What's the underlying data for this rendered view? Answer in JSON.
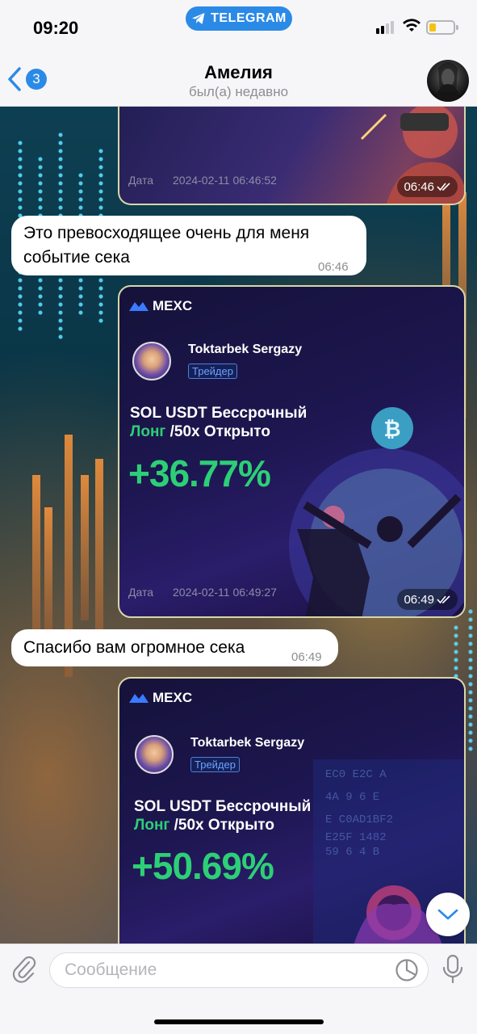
{
  "status_bar": {
    "time": "09:20",
    "app_pill": "TELEGRAM"
  },
  "header": {
    "back_count": "3",
    "contact_name": "Амелия",
    "contact_status": "был(а) недавно"
  },
  "messages": [
    {
      "type": "image",
      "date_label": "Дата",
      "date_value": "2024-02-11 06:46:52",
      "time": "06:46"
    },
    {
      "type": "text",
      "text_line1": "Это превосходящее очень для меня",
      "text_line2": "событие сека",
      "time": "06:46"
    },
    {
      "type": "image",
      "brand": "MEXC",
      "trader_name": "Toktarbek Sergazy",
      "trader_badge": "Трейдер",
      "pair_line1": "SOL USDT Бессрочный",
      "pair_side": "Лонг",
      "pair_rest": "/50x Открыто",
      "profit": "+36.77%",
      "date_label": "Дата",
      "date_value": "2024-02-11 06:49:27",
      "time": "06:49"
    },
    {
      "type": "text",
      "text_line1": "Спасибо вам огромное сека",
      "time": "06:49"
    },
    {
      "type": "image",
      "brand": "MEXC",
      "trader_name": "Toktarbek Sergazy",
      "trader_badge": "Трейдер",
      "pair_line1": "SOL USDT Бессрочный",
      "pair_side": "Лонг",
      "pair_rest": "/50x Открыто",
      "profit": "+50.69%"
    }
  ],
  "composer": {
    "placeholder": "Сообщение"
  },
  "icons": {
    "attach": "paperclip-icon",
    "sticker": "sticker-icon",
    "mic": "microphone-icon",
    "scroll": "chevron-down-icon"
  },
  "colors": {
    "accent": "#2b8ae6",
    "profit_green": "#2dcf76"
  }
}
